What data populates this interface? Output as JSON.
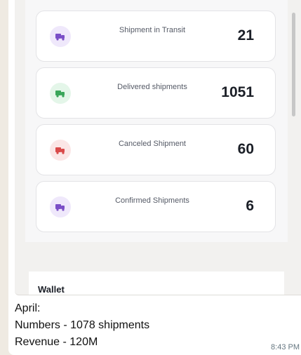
{
  "stats": [
    {
      "label": "Shipment in Transit",
      "count": "21",
      "icon": "truck-icon",
      "icon_color": "#7b4fc7",
      "icon_bg": "#efe8fb"
    },
    {
      "label": "Delivered shipments",
      "count": "1051",
      "icon": "truck-icon",
      "icon_color": "#3aa65a",
      "icon_bg": "#e4f6e9"
    },
    {
      "label": "Canceled Shipment",
      "count": "60",
      "icon": "truck-icon",
      "icon_color": "#d94a4a",
      "icon_bg": "#fbe6e6"
    },
    {
      "label": "Confirmed Shipments",
      "count": "6",
      "icon": "truck-icon",
      "icon_color": "#7b4fc7",
      "icon_bg": "#efe8fb"
    }
  ],
  "wallet": {
    "title": "Wallet"
  },
  "message": {
    "line1": "April:",
    "line2": "Numbers - 1078 shipments",
    "line3": "Revenue - 120M",
    "time": "8:43 PM"
  }
}
